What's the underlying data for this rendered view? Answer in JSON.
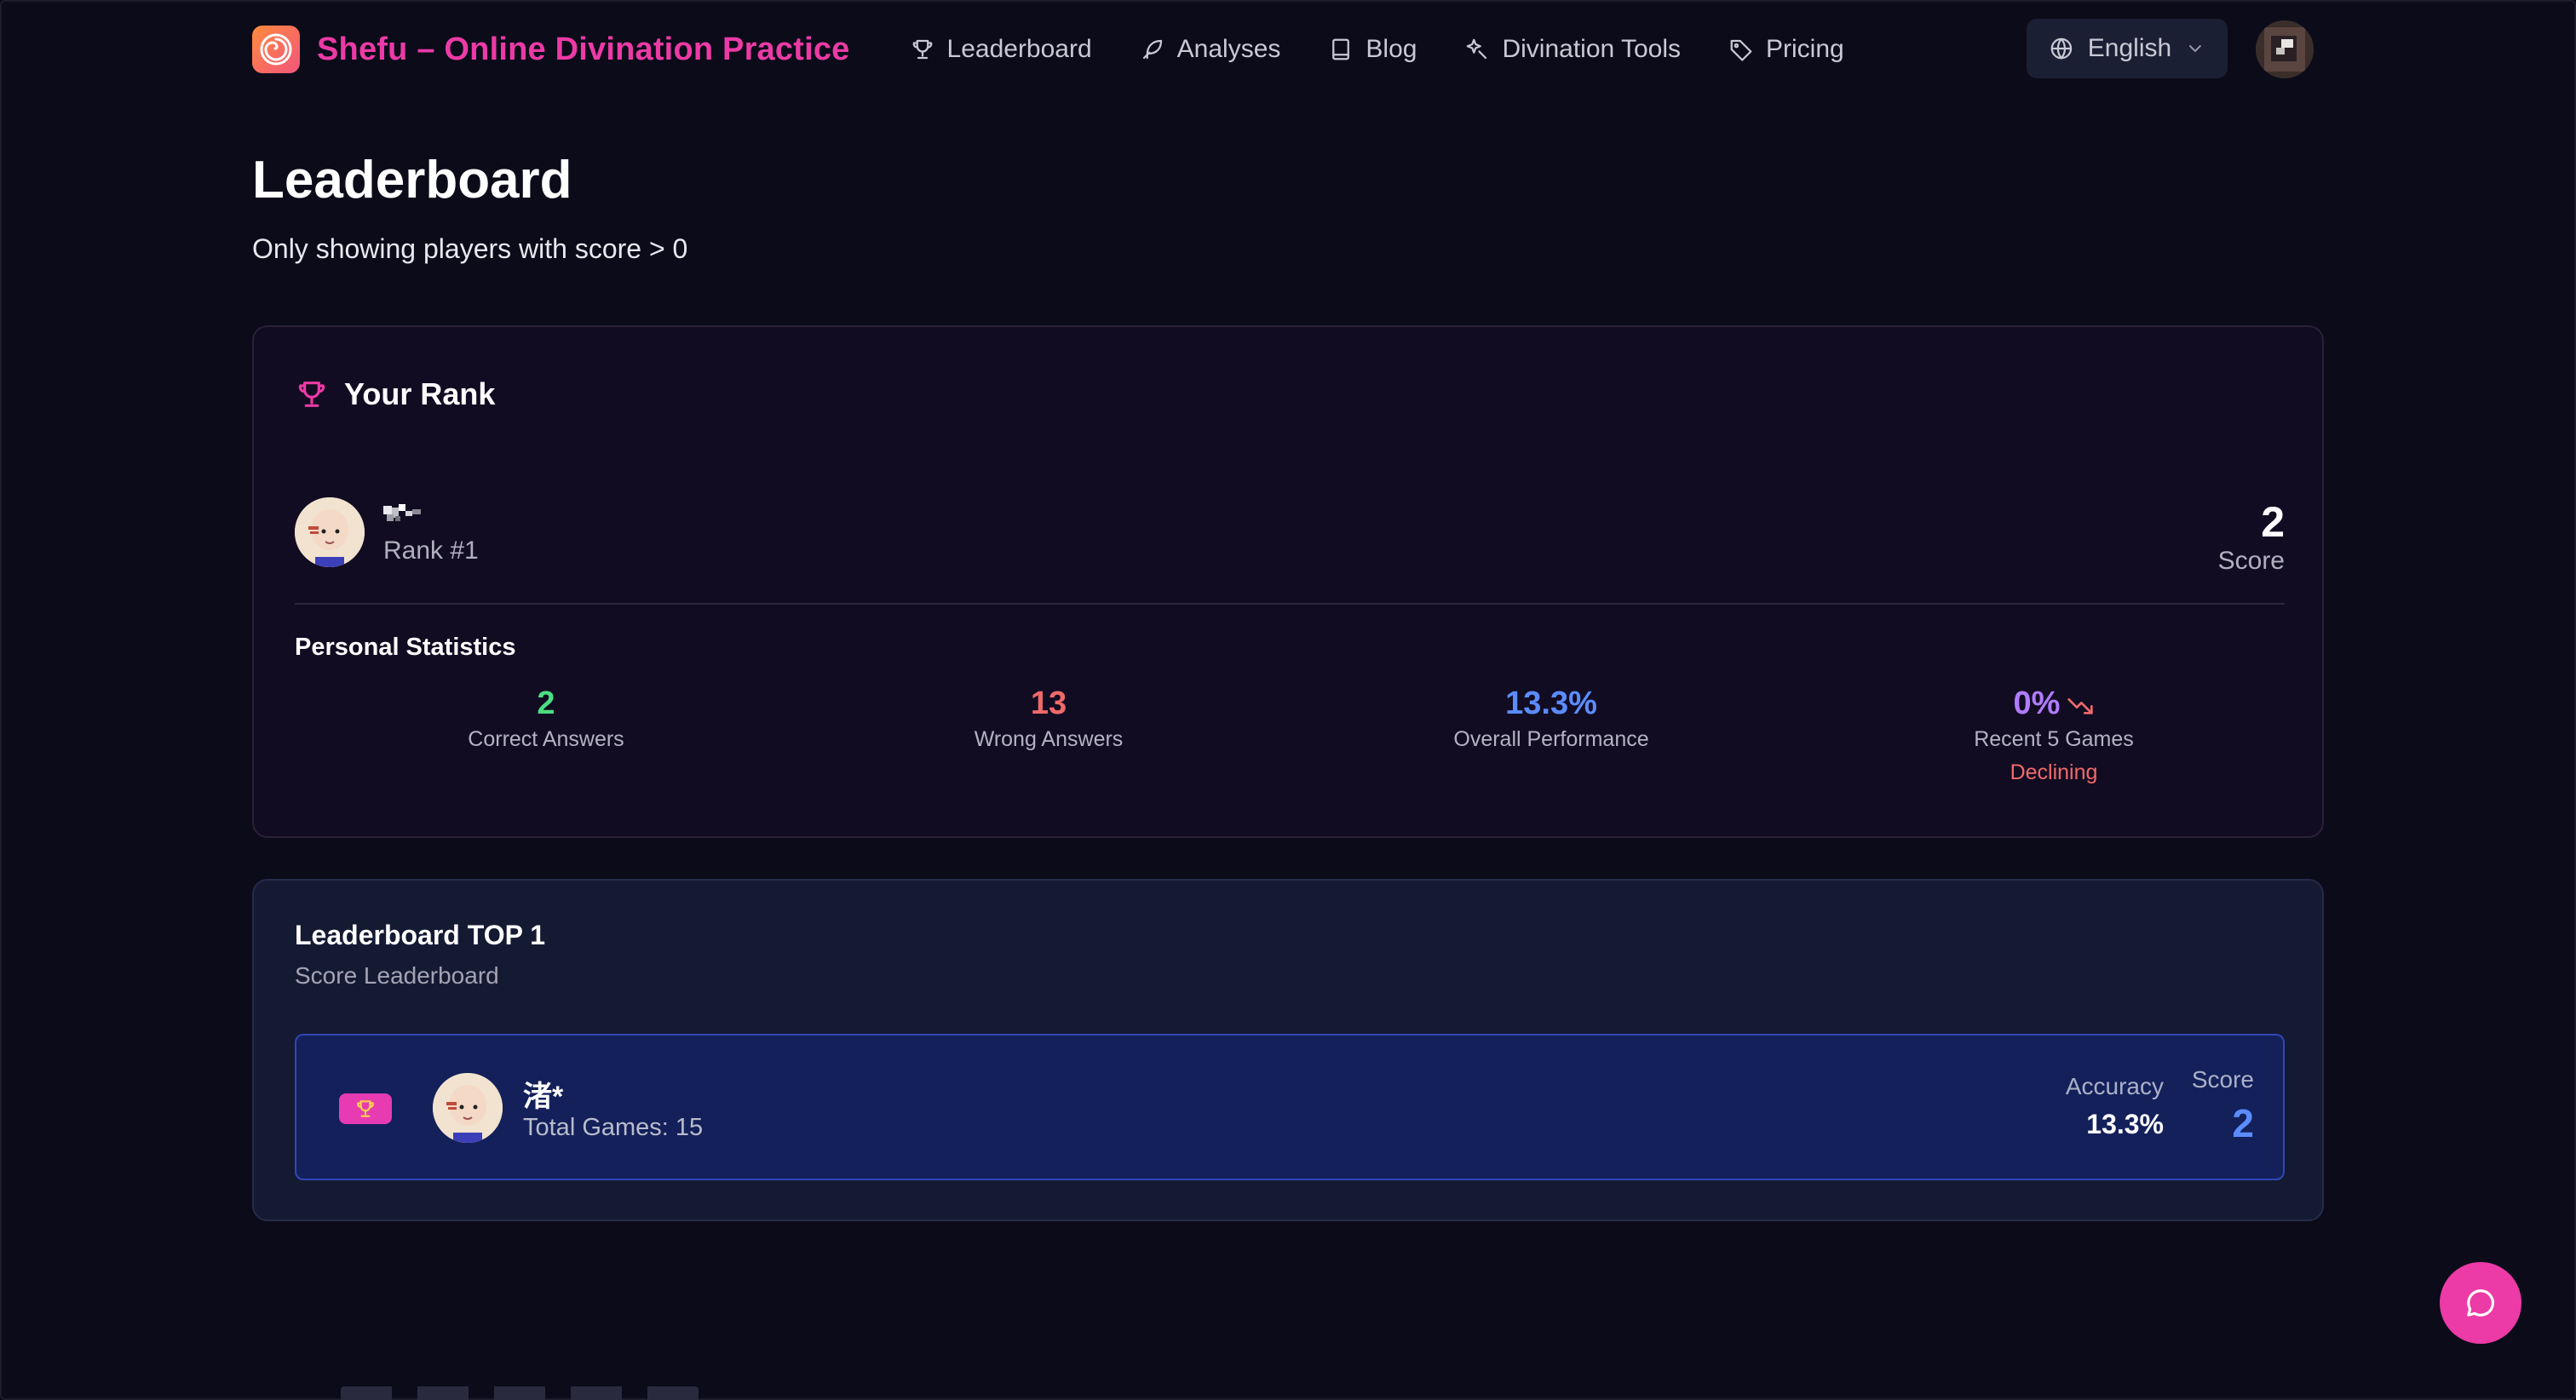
{
  "nav": {
    "brand": "Shefu – Online Divination Practice",
    "links": [
      {
        "label": "Leaderboard",
        "icon": "trophy-icon"
      },
      {
        "label": "Analyses",
        "icon": "feather-icon"
      },
      {
        "label": "Blog",
        "icon": "book-icon"
      },
      {
        "label": "Divination Tools",
        "icon": "sparkle-tool-icon"
      },
      {
        "label": "Pricing",
        "icon": "tag-icon"
      }
    ],
    "language": "English"
  },
  "header": {
    "title": "Leaderboard",
    "subtitle": "Only showing players with score > 0"
  },
  "your_rank": {
    "title": "Your Rank",
    "rank_text": "Rank #1",
    "score": "2",
    "score_label": "Score",
    "stats_title": "Personal Statistics",
    "stats": [
      {
        "value": "2",
        "label": "Correct Answers",
        "color": "#4ade80"
      },
      {
        "value": "13",
        "label": "Wrong Answers",
        "color": "#f06a6a"
      },
      {
        "value": "13.3%",
        "label": "Overall Performance",
        "color": "#5b8cff"
      },
      {
        "value": "0%",
        "label": "Recent 5 Games",
        "color": "#b07cff",
        "note": "Declining"
      }
    ]
  },
  "top": {
    "title": "Leaderboard TOP 1",
    "subtitle": "Score Leaderboard",
    "entries": [
      {
        "name": "渚*",
        "games": "Total Games: 15",
        "accuracy_label": "Accuracy",
        "accuracy": "13.3%",
        "score_label": "Score",
        "score": "2"
      }
    ]
  },
  "colors": {
    "accent": "#ec3aa6",
    "background": "#0b0b19",
    "score_blue": "#5b8cff"
  }
}
